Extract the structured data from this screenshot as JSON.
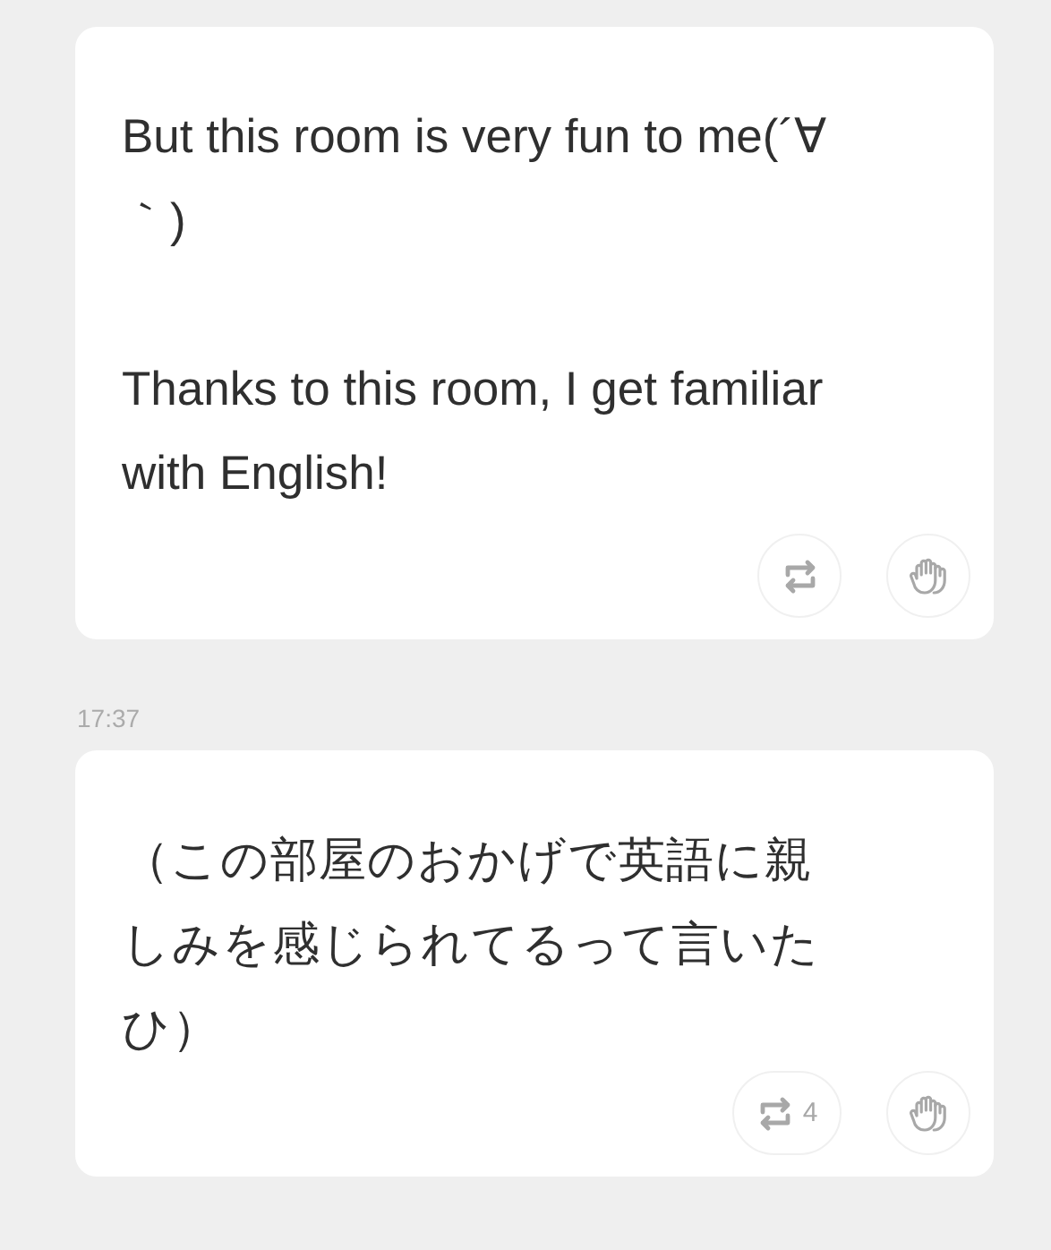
{
  "messages": [
    {
      "paragraphs": [
        "But this room is very fun to me(´∀｀)",
        "Thanks to this room, I get familiar with English!"
      ]
    },
    {
      "time": "17:37",
      "paragraphs": [
        "（この部屋のおかげで英語に親しみを感じられてるって言いたひ）"
      ],
      "repost_count": "4"
    }
  ]
}
